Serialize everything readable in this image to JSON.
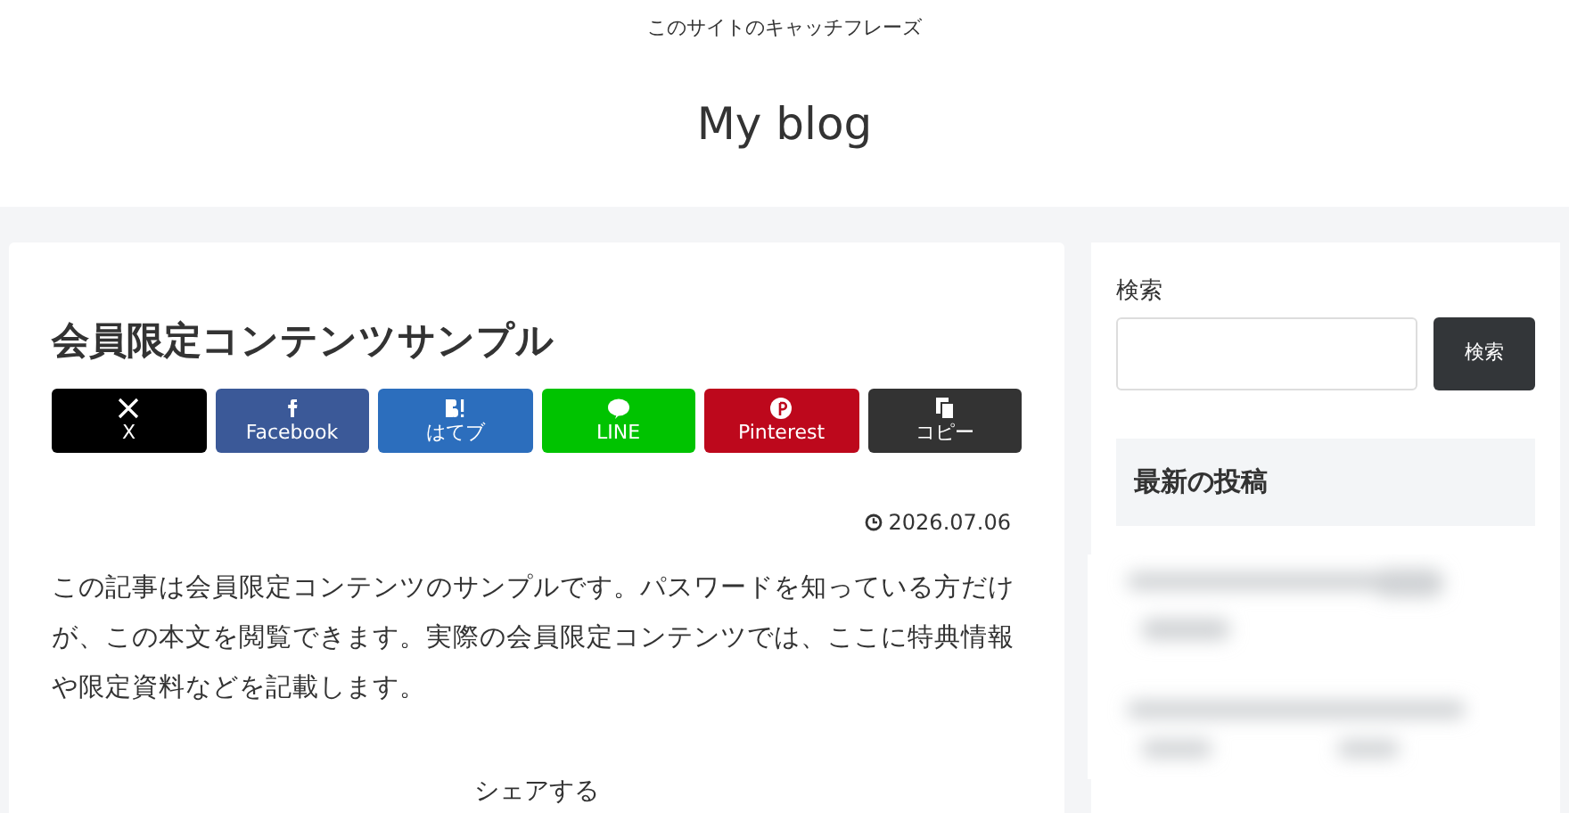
{
  "header": {
    "tagline": "このサイトのキャッチフレーズ",
    "site_title": "My blog"
  },
  "article": {
    "title": "会員限定コンテンツサンプル",
    "share_buttons": [
      {
        "kind": "x",
        "label": "X",
        "color": "#000000"
      },
      {
        "kind": "facebook",
        "label": "Facebook",
        "color": "#3b5998"
      },
      {
        "kind": "hatena",
        "label": "はてブ",
        "color": "#2c6ebd"
      },
      {
        "kind": "line",
        "label": "LINE",
        "color": "#00c300"
      },
      {
        "kind": "pinterest",
        "label": "Pinterest",
        "color": "#bd081c"
      },
      {
        "kind": "copy",
        "label": "コピー",
        "color": "#333333"
      }
    ],
    "date": "2026.07.06",
    "body": "この記事は会員限定コンテンツのサンプルです。パスワードを知っている方だけが、この本文を閲覧できます。実際の会員限定コンテンツでは、ここに特典情報や限定資料などを記載します。",
    "share_heading": "シェアする"
  },
  "sidebar": {
    "search_label": "検索",
    "search_button": "検索",
    "recent_heading": "最新の投稿"
  }
}
